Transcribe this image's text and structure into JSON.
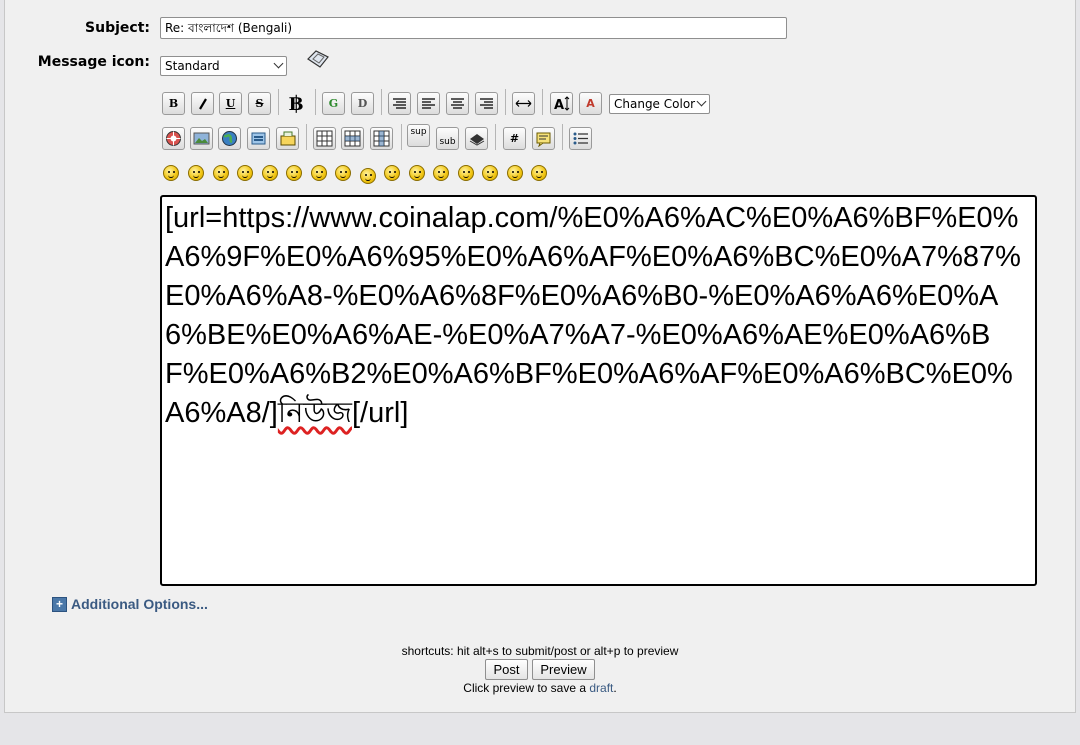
{
  "subject": {
    "label": "Subject:",
    "value": "Re: বাংলাদেশ (Bengali)"
  },
  "message_icon": {
    "label": "Message icon:",
    "value": "Standard"
  },
  "toolbar": {
    "change_color": "Change Color",
    "sup_label": "sup",
    "sub_label": "sub",
    "hash_label": "#"
  },
  "editor": {
    "text_before": "[url=https://www.coinalap.com/%E0%A6%AC%E0%A6%BF%E0%A6%9F%E0%A6%95%E0%A6%AF%E0%A6%BC%E0%A7%87%E0%A6%A8-%E0%A6%8F%E0%A6%B0-%E0%A6%A6%E0%A6%BE%E0%A6%AE-%E0%A7%A7-%E0%A6%AE%E0%A6%BF%E0%A6%B2%E0%A6%BF%E0%A6%AF%E0%A6%BC%E0%A6%A8/]",
    "misspelled": "নিউজ",
    "text_after": "[/url]"
  },
  "additional_options": "Additional Options...",
  "shortcuts": "shortcuts: hit alt+s to submit/post or alt+p to preview",
  "buttons": {
    "post": "Post",
    "preview": "Preview"
  },
  "draft_note": {
    "before": "Click preview to save a ",
    "link": "draft",
    "after": "."
  }
}
